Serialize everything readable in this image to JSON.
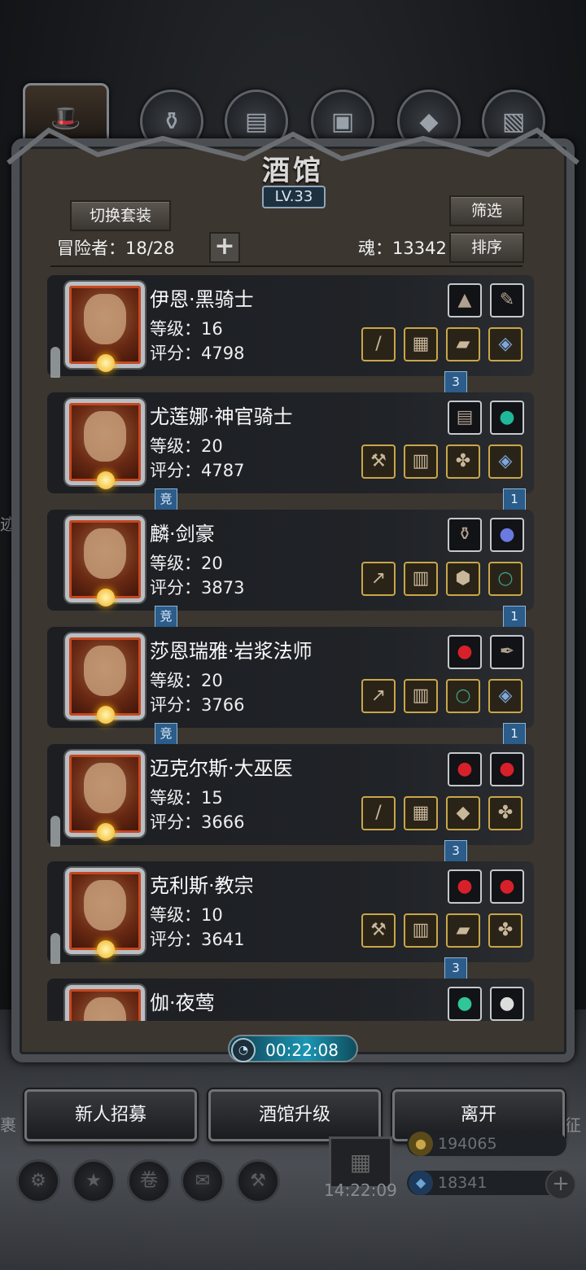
{
  "title": "酒馆",
  "level": "LV.33",
  "buttons": {
    "switch_outfit": "切换套装",
    "filter": "筛选",
    "sort": "排序",
    "recruit": "新人招募",
    "upgrade": "酒馆升级",
    "leave": "离开"
  },
  "stats": {
    "adventurers": "冒险者：18/28",
    "soul": "魂：13342",
    "add": "+"
  },
  "timer": "00:22:08",
  "heroes": [
    {
      "name": "伊恩·黑骑士",
      "level": "等级：16",
      "score": "评分：4798",
      "top_icons": [
        "ore-icon",
        "scroll-icon"
      ],
      "bottom_icons": [
        "sword-icon",
        "armor-icon",
        "boots-icon",
        "amulet-icon"
      ],
      "bottom_badge": "3",
      "badge_side": "right",
      "left_badge": "",
      "ghost": true
    },
    {
      "name": "尤莲娜·神官骑士",
      "level": "等级：20",
      "score": "评分：4787",
      "top_icons": [
        "book-icon",
        "gem-icon"
      ],
      "bottom_icons": [
        "axe-icon",
        "cape-icon",
        "necklace-icon",
        "amulet-icon"
      ],
      "bottom_badge": "1",
      "badge_side": "far-right",
      "left_badge": "竞",
      "ghost": false
    },
    {
      "name": "麟·剑豪",
      "level": "等级：20",
      "score": "评分：3873",
      "top_icons": [
        "vase-icon",
        "orb-icon"
      ],
      "bottom_icons": [
        "spear-icon",
        "robe-icon",
        "shield-icon",
        "ring-icon"
      ],
      "bottom_badge": "1",
      "badge_side": "far-right",
      "left_badge": "竞",
      "ghost": false
    },
    {
      "name": "莎恩瑞雅·岩浆法师",
      "level": "等级：20",
      "score": "评分：3766",
      "top_icons": [
        "ruby-icon",
        "feather-icon"
      ],
      "bottom_icons": [
        "staff-icon",
        "robe-icon",
        "ring-icon",
        "amulet-icon"
      ],
      "bottom_badge": "1",
      "badge_side": "far-right",
      "left_badge": "竞",
      "ghost": false
    },
    {
      "name": "迈克尔斯·大巫医",
      "level": "等级：15",
      "score": "评分：3666",
      "top_icons": [
        "ruby-icon",
        "ruby-icon"
      ],
      "bottom_icons": [
        "rod-icon",
        "armor-icon",
        "pendant-icon",
        "necklace-icon"
      ],
      "bottom_badge": "3",
      "badge_side": "right",
      "left_badge": "",
      "ghost": true
    },
    {
      "name": "克利斯·教宗",
      "level": "等级：10",
      "score": "评分：3641",
      "top_icons": [
        "ruby-icon",
        "ruby-icon"
      ],
      "bottom_icons": [
        "hammer-icon",
        "robe-icon",
        "boots-icon",
        "necklace-icon"
      ],
      "bottom_badge": "3",
      "badge_side": "right",
      "left_badge": "",
      "ghost": true
    },
    {
      "name": "伽·夜莺",
      "level": "",
      "score": "",
      "top_icons": [
        "emerald-icon",
        "pearl-icon"
      ],
      "bottom_icons": [],
      "bottom_badge": "",
      "badge_side": "",
      "left_badge": "",
      "ghost": false
    }
  ],
  "resources": {
    "gold": "194065",
    "crystal": "18341",
    "gift_timer": "14:22:09"
  },
  "side_chars": {
    "left_1": "迹",
    "left_2": "裹",
    "right_1": "征"
  }
}
